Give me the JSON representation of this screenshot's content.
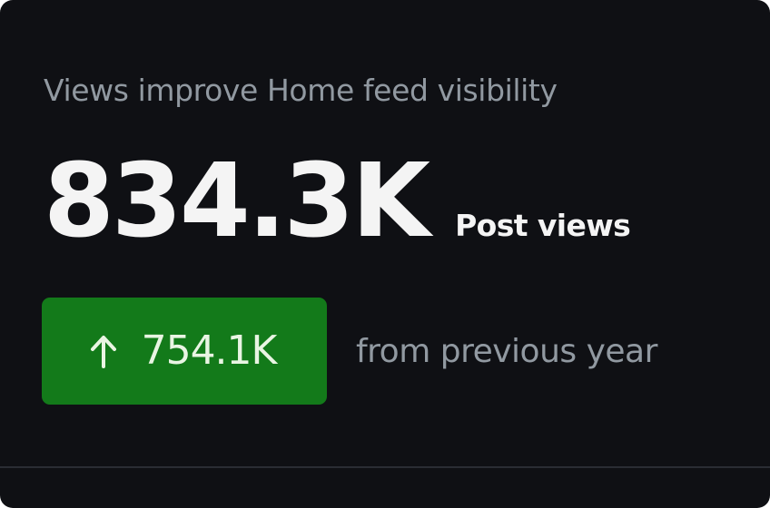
{
  "card": {
    "subtitle": "Views improve Home feed visibility",
    "metric": {
      "value": "834.3K",
      "label": "Post views"
    },
    "delta": {
      "direction_icon": "arrow-up-icon",
      "value": "754.1K",
      "caption": "from previous year",
      "badge_color": "#137a1a"
    }
  },
  "colors": {
    "background": "#0f1014",
    "primary_text": "#f4f4f4",
    "secondary_text": "#9199a1",
    "positive": "#137a1a"
  }
}
